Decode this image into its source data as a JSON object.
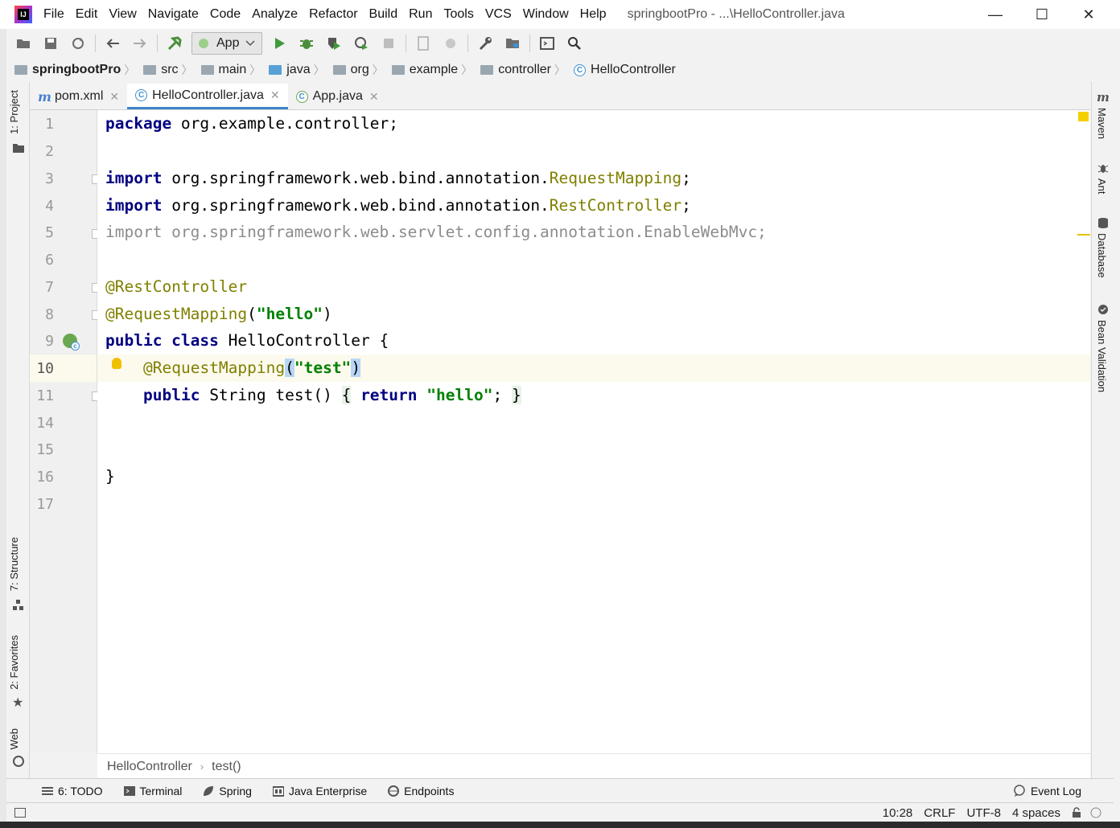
{
  "window": {
    "title": "springbootPro - ...\\HelloController.java",
    "logo_text": "IJ",
    "minimize": "—",
    "maximize": "☐",
    "close": "✕"
  },
  "menu": [
    "File",
    "Edit",
    "View",
    "Navigate",
    "Code",
    "Analyze",
    "Refactor",
    "Build",
    "Run",
    "Tools",
    "VCS",
    "Window",
    "Help"
  ],
  "toolbar": {
    "run_config": "App"
  },
  "breadcrumbs": [
    "springbootPro",
    "src",
    "main",
    "java",
    "org",
    "example",
    "controller",
    "HelloController"
  ],
  "left_tools": {
    "project": "1: Project",
    "structure": "7: Structure",
    "favorites": "2: Favorites",
    "web": "Web"
  },
  "right_tools": {
    "maven": "Maven",
    "ant": "Ant",
    "database": "Database",
    "bean_validation": "Bean Validation"
  },
  "tabs": [
    {
      "label": "pom.xml",
      "icon": "maven-icon",
      "active": false
    },
    {
      "label": "HelloController.java",
      "icon": "class-icon",
      "active": true
    },
    {
      "label": "App.java",
      "icon": "class-icon",
      "active": false
    }
  ],
  "editor": {
    "line_numbers": [
      "1",
      "2",
      "3",
      "4",
      "5",
      "6",
      "7",
      "8",
      "9",
      "10",
      "11",
      "14",
      "15",
      "16",
      "17"
    ],
    "current_line": "10",
    "code": {
      "l1_kw": "package",
      "l1_rest": " org.example.controller;",
      "l3_kw": "import",
      "l3_pkg": " org.springframework.web.bind.annotation.",
      "l3_cls": "RequestMapping",
      "l3_end": ";",
      "l4_kw": "import",
      "l4_pkg": " org.springframework.web.bind.annotation.",
      "l4_cls": "RestController",
      "l4_end": ";",
      "l5": "import org.springframework.web.servlet.config.annotation.EnableWebMvc;",
      "l7": "@RestController",
      "l8_ann": "@RequestMapping",
      "l8_open": "(",
      "l8_str": "\"hello\"",
      "l8_close": ")",
      "l9_kw": "public class",
      "l9_rest": " HelloController {",
      "l10_ann": "@RequestMapping",
      "l10_open": "(",
      "l10_str": "\"test\"",
      "l10_close": ")",
      "l11_kw": "public",
      "l11_rest": " String test() ",
      "l11_open": "{",
      "l11_ret": "return",
      "l11_str": "\"hello\"",
      "l11_semi": ";",
      "l11_close": "}",
      "l16": "}"
    }
  },
  "code_breadcrumbs": [
    "HelloController",
    "test()"
  ],
  "bottom_tools": [
    {
      "label": "6: TODO"
    },
    {
      "label": "Terminal"
    },
    {
      "label": "Spring"
    },
    {
      "label": "Java Enterprise"
    },
    {
      "label": "Endpoints"
    }
  ],
  "event_log": "Event Log",
  "status": {
    "position": "10:28",
    "line_sep": "CRLF",
    "encoding": "UTF-8",
    "indent": "4 spaces"
  }
}
